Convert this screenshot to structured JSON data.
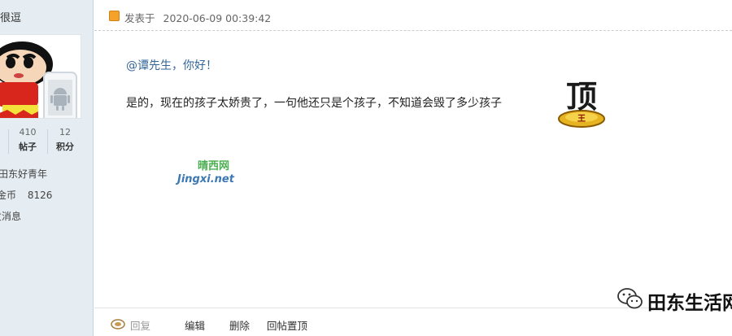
{
  "sidebar": {
    "title_fragment": "很逗",
    "stats": [
      {
        "value": "410",
        "label": "帖子"
      },
      {
        "value": "12",
        "label": "积分"
      }
    ],
    "group": "田东好青年",
    "coins_label": "金币",
    "coins_value": "8126",
    "send_message": "发消息"
  },
  "post": {
    "posted_label": "发表于",
    "date": "2020-06-09 00:39:42",
    "mention": "@谭先生，你好！",
    "body": "是的，现在的孩子太娇贵了，一句他还只是个孩子，不知道会毁了多少孩子",
    "emoji_char": "顶",
    "emoji_sub": "王"
  },
  "watermark": {
    "cn": "晴西网",
    "en": "Jingxi.net"
  },
  "footer": {
    "reply": "回复",
    "edit": "编辑",
    "delete": "删除",
    "pin": "回帖置顶"
  },
  "brand": {
    "name": "田东生活网"
  },
  "colors": {
    "sidebar_bg": "#e5edf2",
    "mention": "#336699",
    "watermark_cn": "#4caf50",
    "watermark_en": "#3c78b4"
  }
}
